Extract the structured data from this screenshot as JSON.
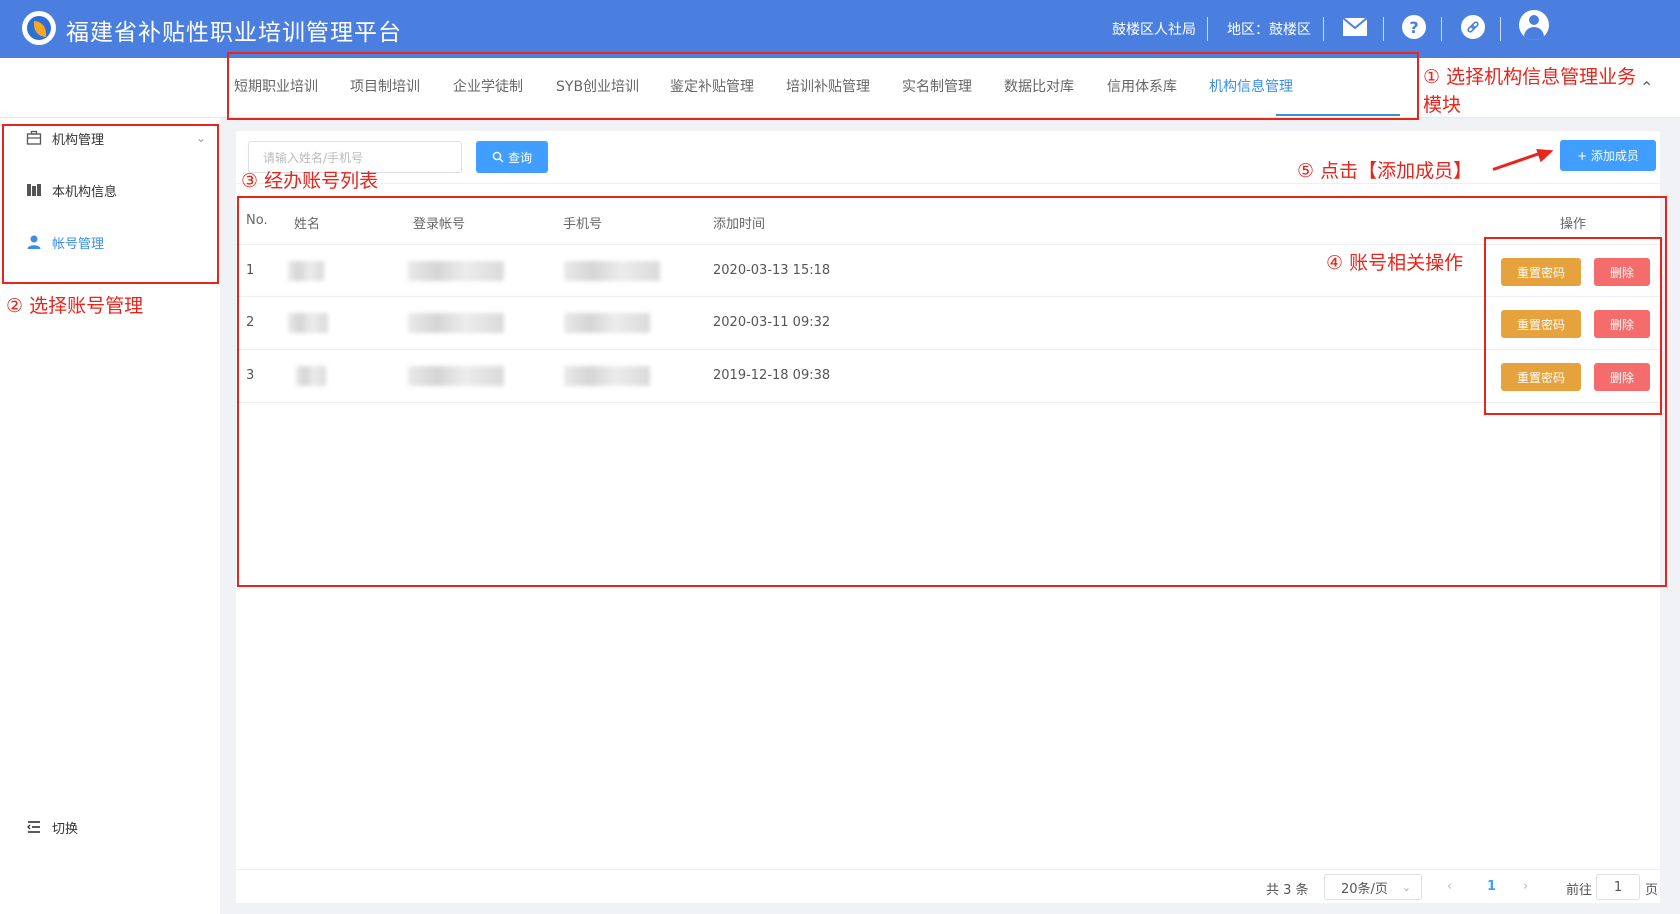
{
  "header": {
    "title": "福建省补贴性职业培训管理平台",
    "org": "鼓楼区人社局",
    "region": "地区：鼓楼区"
  },
  "nav": {
    "tabs": [
      "短期职业培训",
      "项目制培训",
      "企业学徒制",
      "SYB创业培训",
      "鉴定补贴管理",
      "培训补贴管理",
      "实名制管理",
      "数据比对库",
      "信用体系库",
      "机构信息管理"
    ],
    "active_tab": "机构信息管理"
  },
  "sidebar": {
    "items": [
      {
        "label": "机构管理",
        "icon": "briefcase-icon"
      },
      {
        "label": "本机构信息",
        "icon": "building-icon"
      },
      {
        "label": "帐号管理",
        "icon": "user-icon"
      }
    ],
    "active_item": "帐号管理",
    "switch_label": "切换"
  },
  "search": {
    "placeholder": "请输入姓名/手机号",
    "button": "查询"
  },
  "add_button": "+ 添加成员",
  "table": {
    "columns": [
      "No.",
      "姓名",
      "登录帐号",
      "手机号",
      "添加时间",
      "操作"
    ],
    "rows": [
      {
        "no": "1",
        "time": "2020-03-13 15:18"
      },
      {
        "no": "2",
        "time": "2020-03-11 09:32"
      },
      {
        "no": "3",
        "time": "2019-12-18 09:38"
      }
    ],
    "reset_label": "重置密码",
    "delete_label": "删除"
  },
  "pagination": {
    "total": "共 3 条",
    "page_size": "20条/页",
    "prev": "‹",
    "current": "1",
    "next": "›",
    "goto_label": "前往",
    "goto_value": "1",
    "page_suffix": "页"
  },
  "annotations": {
    "a1_line1": "① 选择机构信息管理业务",
    "a1_line2": "模块",
    "a2": "② 选择账号管理",
    "a3": "③ 经办账号列表",
    "a4": "④ 账号相关操作",
    "a5": "⑤ 点击【添加成员】"
  },
  "colors": {
    "header": "#4a7fe0",
    "primary": "#409eff",
    "warning": "#e6a23c",
    "danger": "#f56c6c",
    "annotation": "#e8241b"
  }
}
